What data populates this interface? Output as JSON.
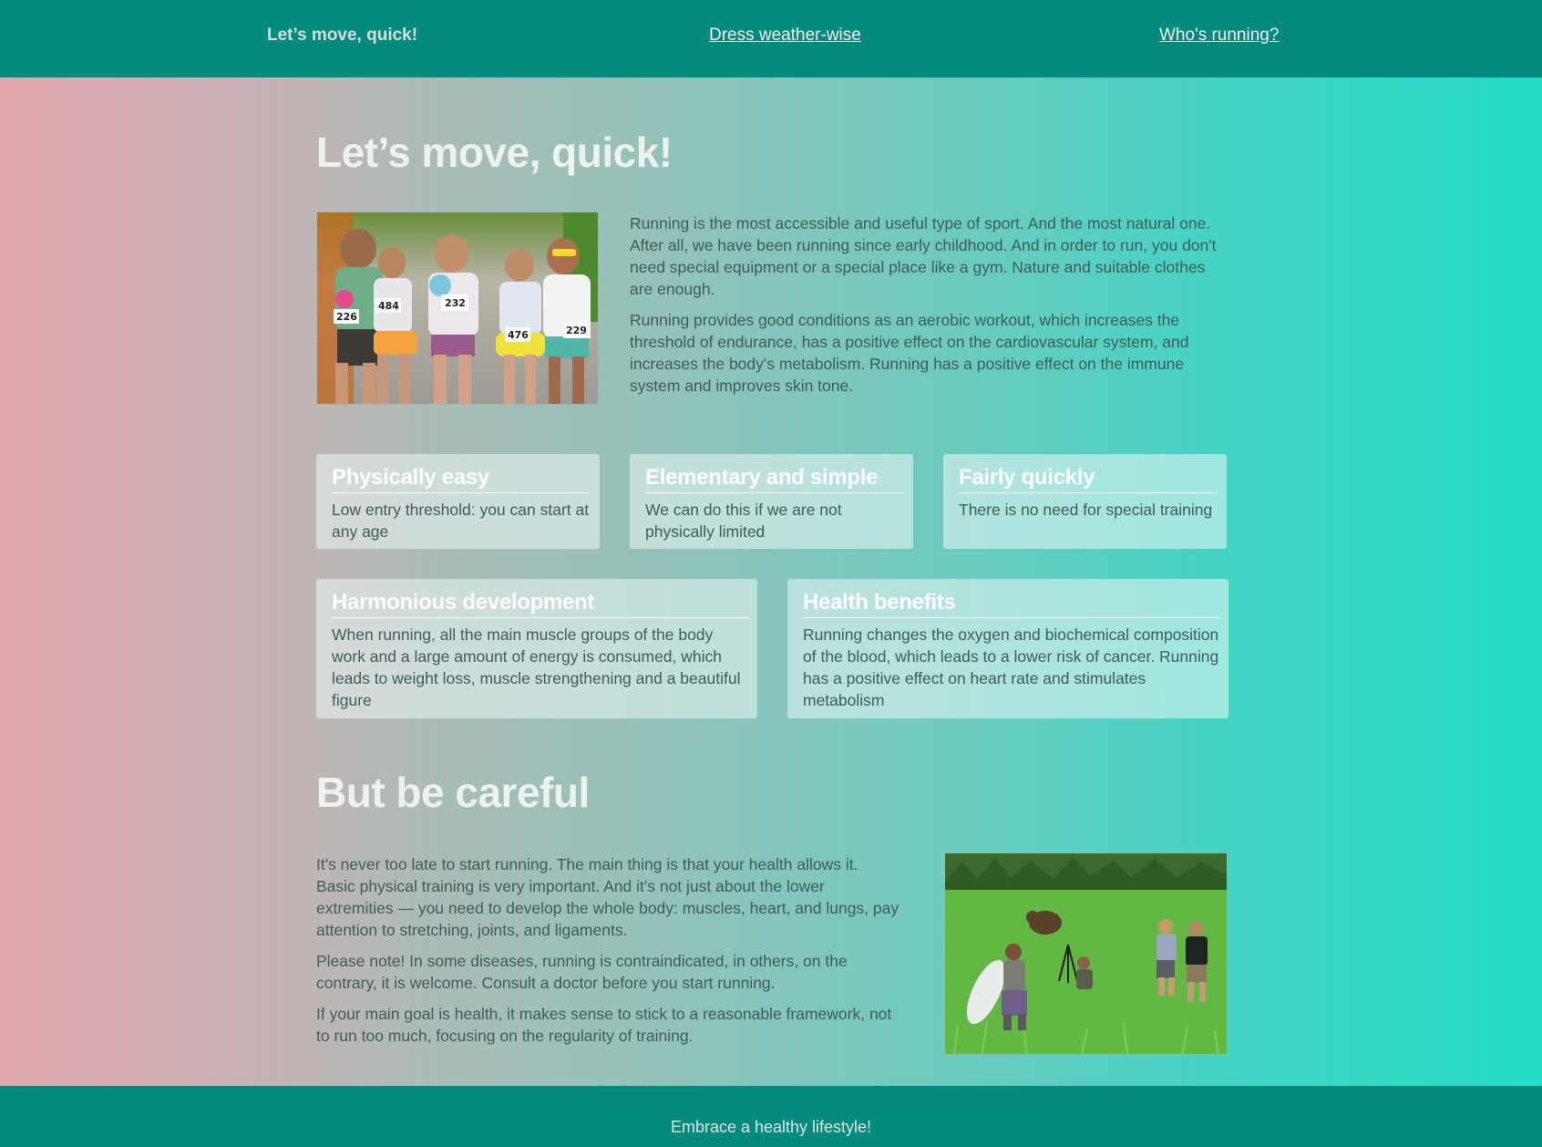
{
  "nav": {
    "current": "Let’s move, quick!",
    "dress": "Dress weather-wise",
    "who": "Who's running?"
  },
  "section1": {
    "title": "Let’s move, quick!",
    "paragraphs": [
      "Running is the most accessible and useful type of sport. And the most natural one. After all, we have been running since early childhood. And in order to run, you don't need special equipment or a special place like a gym. Nature and suitable clothes are enough.",
      "Running provides good conditions as an aerobic workout, which increases the threshold of endurance, has a positive effect on the cardiovascular system, and increases the body's metabolism. Running has a positive effect on the immune system and improves skin tone."
    ],
    "photo_bibs": [
      "226",
      "484",
      "232",
      "476",
      "229"
    ]
  },
  "cards": [
    {
      "title": "Physically easy",
      "text": "Low entry threshold: you can start at any age"
    },
    {
      "title": "Elementary and simple",
      "text": "We can do this if we are not physically limited"
    },
    {
      "title": "Fairly quickly",
      "text": "There is no need for special training"
    },
    {
      "title": "Harmonious development",
      "text": "When running, all the main muscle groups of the body work and a large amount of energy is consumed, which leads to weight loss, muscle strengthening and a beautiful figure"
    },
    {
      "title": "Health benefits",
      "text": "Running changes the oxygen and biochemical composition of the blood, which leads to a lower risk of cancer. Running has a positive effect on heart rate and stimulates metabolism"
    }
  ],
  "section2": {
    "title": "But be careful",
    "paragraphs": [
      "It's never too late to start running. The main thing is that your health allows it. Basic physical training is very important. And it's not just about the lower extremities — you need to develop the whole body: muscles, heart, and lungs, pay attention to stretching, joints, and ligaments.",
      "Please note! In some diseases, running is contraindicated, in others, on the contrary, it is welcome. Consult a doctor before you start running.",
      "If your main goal is health, it makes sense to stick to a reasonable framework, not to run too much, focusing on the regularity of training."
    ]
  },
  "footer": {
    "text": "Embrace a healthy lifestyle!"
  },
  "colors": {
    "header": "#038b7d",
    "gradient_left": "#e2a8ae",
    "gradient_right": "#23dcc8",
    "text": "#3f5c58"
  }
}
